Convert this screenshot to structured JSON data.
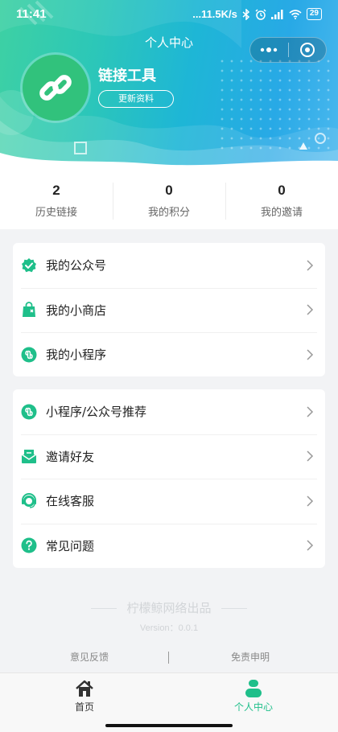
{
  "status_bar": {
    "time": "11:41",
    "network_speed": "...11.5K/s",
    "battery": "29"
  },
  "navbar": {
    "title": "个人中心"
  },
  "profile": {
    "name": "链接工具",
    "update_button": "更新资料",
    "avatar_icon": "link-icon"
  },
  "stats": [
    {
      "value": "2",
      "label": "历史链接"
    },
    {
      "value": "0",
      "label": "我的积分"
    },
    {
      "value": "0",
      "label": "我的邀请"
    }
  ],
  "menu_group_1": [
    {
      "label": "我的公众号",
      "icon": "verified-badge-icon"
    },
    {
      "label": "我的小商店",
      "icon": "shopping-bag-icon"
    },
    {
      "label": "我的小程序",
      "icon": "mini-program-icon"
    }
  ],
  "menu_group_2": [
    {
      "label": "小程序/公众号推荐",
      "icon": "mini-program-icon"
    },
    {
      "label": "邀请好友",
      "icon": "invite-mail-icon"
    },
    {
      "label": "在线客服",
      "icon": "customer-service-icon"
    },
    {
      "label": "常见问题",
      "icon": "question-icon"
    }
  ],
  "footer": {
    "brand": "柠檬鲸网络出品",
    "version": "Version：0.0.1",
    "feedback_link": "意见反馈",
    "disclaimer_link": "免责申明"
  },
  "tabbar": {
    "home": "首页",
    "me": "个人中心"
  },
  "colors": {
    "accent": "#1fbf8a",
    "header_start": "#3ed1a3",
    "header_end": "#28a9e6"
  }
}
